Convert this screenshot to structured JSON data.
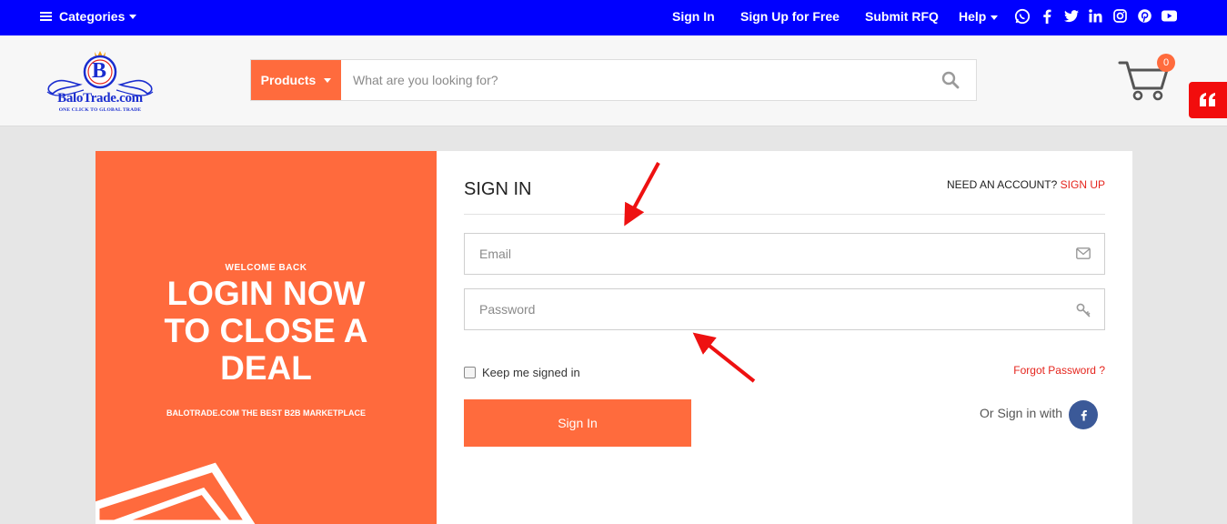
{
  "topbar": {
    "categories_label": "Categories",
    "sign_in": "Sign In",
    "sign_up": "Sign Up for Free",
    "submit_rfq": "Submit RFQ",
    "help": "Help",
    "social_icons": [
      "whatsapp-icon",
      "facebook-icon",
      "twitter-icon",
      "linkedin-icon",
      "instagram-icon",
      "pinterest-icon",
      "youtube-icon"
    ],
    "bg_color": "#0000ff"
  },
  "header": {
    "logo_letter": "B",
    "logo_text": "BaloTrade.com",
    "logo_tagline": "ONE CLICK TO GLOBAL TRADE",
    "products_label": "Products",
    "search_placeholder": "What are you looking for?",
    "cart_count": "0",
    "quote_icon": "quote-icon"
  },
  "promo": {
    "welcome": "WELCOME BACK",
    "headline_line1": "LOGIN NOW",
    "headline_line2": "TO CLOSE A",
    "headline_line3": "DEAL",
    "tagline": "BALOTRADE.COM THE BEST B2B MARKETPLACE",
    "accent_color": "#ff6a3d"
  },
  "signin": {
    "title": "SIGN IN",
    "need_account": "NEED AN ACCOUNT?",
    "sign_up_link": "SIGN UP",
    "email_placeholder": "Email",
    "password_placeholder": "Password",
    "keep_signed_in": "Keep me signed in",
    "forgot_password": "Forgot Password ?",
    "button_label": "Sign In",
    "or_sign_in_with": "Or Sign in with",
    "link_color": "#e5251d"
  }
}
